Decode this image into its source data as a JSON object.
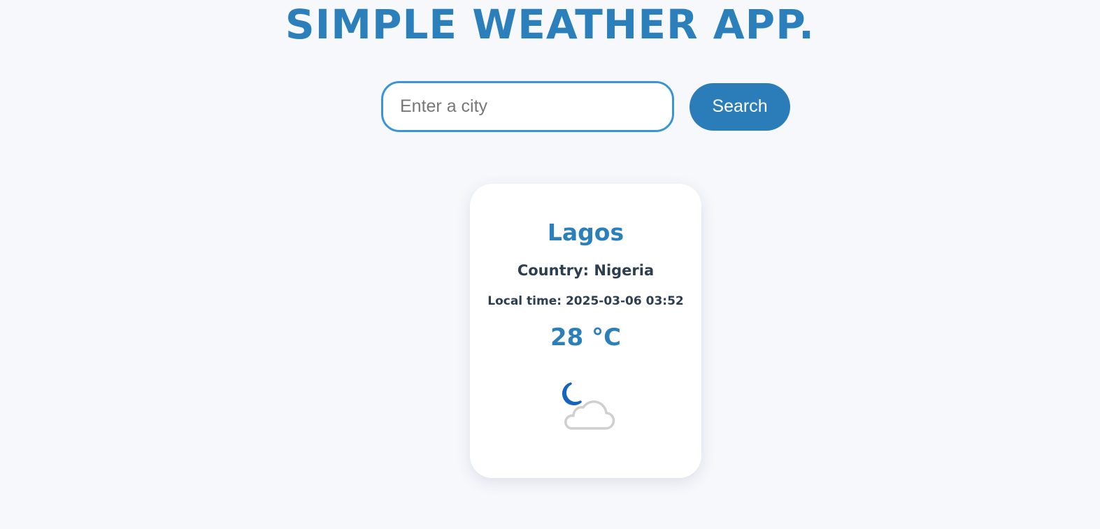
{
  "app": {
    "title": "SIMPLE WEATHER APP."
  },
  "search": {
    "placeholder": "Enter a city",
    "value": "",
    "button_label": "Search"
  },
  "weather": {
    "city": "Lagos",
    "country_text": "Country: Nigeria",
    "local_time_text": "Local time: 2025-03-06 03:52",
    "temperature_text": "28 °C",
    "icon": "partly-cloudy-night-icon"
  },
  "colors": {
    "accent": "#2b80bb",
    "button": "#2a7db8",
    "input_border": "#3a95d6",
    "text_dark": "#2c3e50",
    "background": "#f6f8fc",
    "moon": "#1565c0",
    "cloud": "#cfcfcf"
  }
}
